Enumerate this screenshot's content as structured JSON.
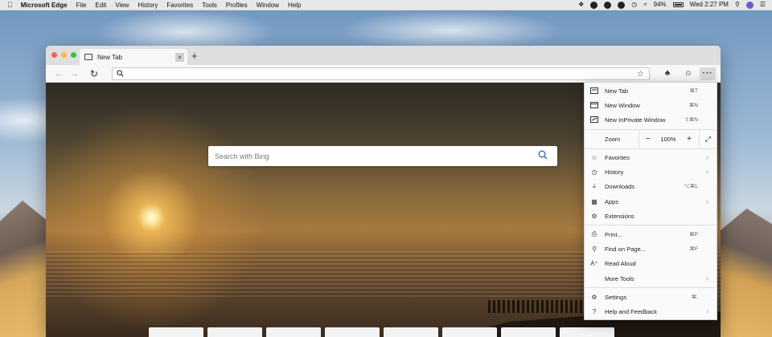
{
  "menubar": {
    "app_name": "Microsoft Edge",
    "items": [
      "File",
      "Edit",
      "View",
      "History",
      "Favorites",
      "Tools",
      "Profiles",
      "Window",
      "Help"
    ],
    "battery": "94%",
    "clock": "Wed 2:27 PM"
  },
  "browser": {
    "tab": {
      "title": "New Tab",
      "close": "×"
    },
    "new_tab_button": "+",
    "address": {
      "value": ""
    }
  },
  "page": {
    "search_placeholder": "Search with Bing"
  },
  "menu": {
    "items": [
      {
        "label": "New Tab",
        "shortcut": "⌘T",
        "icon": "new-tab-icon"
      },
      {
        "label": "New Window",
        "shortcut": "⌘N",
        "icon": "window-icon"
      },
      {
        "label": "New InPrivate Window",
        "shortcut": "⇧⌘N",
        "icon": "inprivate-icon"
      },
      {
        "label": "Favorites",
        "icon": "star-icon",
        "submenu": true
      },
      {
        "label": "History",
        "icon": "history-icon",
        "submenu": true
      },
      {
        "label": "Downloads",
        "shortcut": "⌥⌘L",
        "icon": "download-icon"
      },
      {
        "label": "Apps",
        "icon": "apps-icon",
        "submenu": true
      },
      {
        "label": "Extensions",
        "icon": "extensions-icon"
      },
      {
        "label": "Print...",
        "shortcut": "⌘P",
        "icon": "print-icon"
      },
      {
        "label": "Find on Page...",
        "shortcut": "⌘F",
        "icon": "find-icon"
      },
      {
        "label": "Read Aloud",
        "icon": "read-aloud-icon"
      },
      {
        "label": "More Tools",
        "icon": "",
        "submenu": true
      },
      {
        "label": "Settings",
        "shortcut": "⌘,",
        "icon": "gear-icon"
      },
      {
        "label": "Help and Feedback",
        "icon": "help-icon",
        "submenu": true
      }
    ],
    "zoom": {
      "label": "Zoom",
      "value": "100%",
      "minus": "−",
      "plus": "+"
    }
  }
}
